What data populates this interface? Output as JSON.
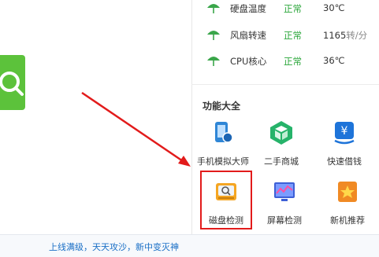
{
  "hardware_rows": [
    {
      "name": "硬盘温度",
      "status": "正常",
      "value": "30℃",
      "unit": ""
    },
    {
      "name": "风扇转速",
      "status": "正常",
      "value": "1165",
      "unit": "转/分"
    },
    {
      "name": "CPU核心",
      "status": "正常",
      "value": "36℃",
      "unit": ""
    }
  ],
  "section_title": "功能大全",
  "features": [
    {
      "label": "手机模拟大师",
      "icon": "phone-simulator-icon"
    },
    {
      "label": "二手商城",
      "icon": "secondhand-mall-icon"
    },
    {
      "label": "快速借钱",
      "icon": "quick-loan-icon"
    },
    {
      "label": "磁盘检测",
      "icon": "disk-check-icon"
    },
    {
      "label": "屏幕检测",
      "icon": "screen-check-icon"
    },
    {
      "label": "新机推荐",
      "icon": "new-device-recommend-icon"
    }
  ],
  "ticker": "上线满级，天天攻沙，新中变灭神",
  "colors": {
    "status_ok": "#2aa63a",
    "highlight": "#e21b1b",
    "brand_green": "#5cc23b",
    "link_blue": "#1a6fc6"
  }
}
